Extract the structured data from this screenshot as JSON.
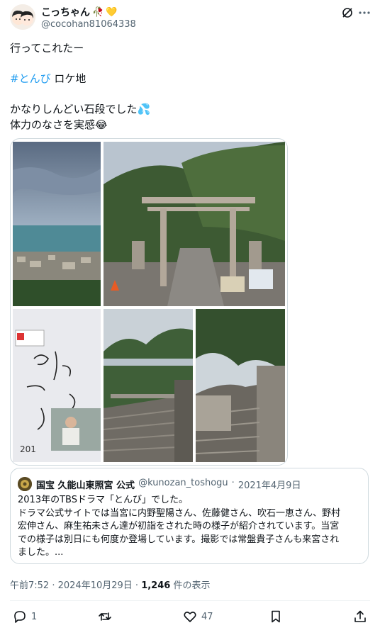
{
  "author": {
    "display_name": "こっちゃん",
    "emoji_1": "🥀",
    "emoji_2": "💛",
    "handle": "@cocohan81064338",
    "avatar": "avatar-illustration"
  },
  "header_icons": [
    "grok-icon",
    "more-options-icon"
  ],
  "tweet": {
    "line1": "行ってこれたー",
    "hashtag": "#とんび",
    "hashtag_suffix": " ロケ地",
    "line3": "かなりしんどい石段でした",
    "line3_emoji": "💦",
    "line4": "体力のなさを実感",
    "line4_emoji": "😂"
  },
  "media": [
    {
      "label": "seaside-town-view-photo"
    },
    {
      "label": "torii-gate-stone-stairs-photo"
    },
    {
      "label": "autograph-board-photo"
    },
    {
      "label": "stone-stairs-photo-1"
    },
    {
      "label": "stone-stairs-photo-2"
    }
  ],
  "quote": {
    "name": "国宝 久能山東照宮 公式",
    "handle": "@kunozan_toshogu",
    "separator": "·",
    "date": "2021年4月9日",
    "lines": [
      "2013年のTBSドラマ「とんび」でした。",
      "ドラマ公式サイトでは当宮に内野聖陽さん、佐藤健さん、吹石一恵さん、野村",
      "宏伸さん、麻生祐未さん達が初詣をされた時の様子が紹介されています。当宮",
      "での様子は別日にも何度か登場しています。撮影では常盤貴子さんも来宮され",
      "ました。..."
    ]
  },
  "meta": {
    "time": "午前7:52",
    "separator": " · ",
    "date": "2024年10月29日",
    "views_count": "1,246",
    "views_label": " 件の表示"
  },
  "actions": {
    "reply_count": "1",
    "retweet_count": "",
    "like_count": "47"
  },
  "colors": {
    "link": "#1d9bf0",
    "text": "#0f1419",
    "secondary": "#536471",
    "border": "#cfd9de"
  }
}
